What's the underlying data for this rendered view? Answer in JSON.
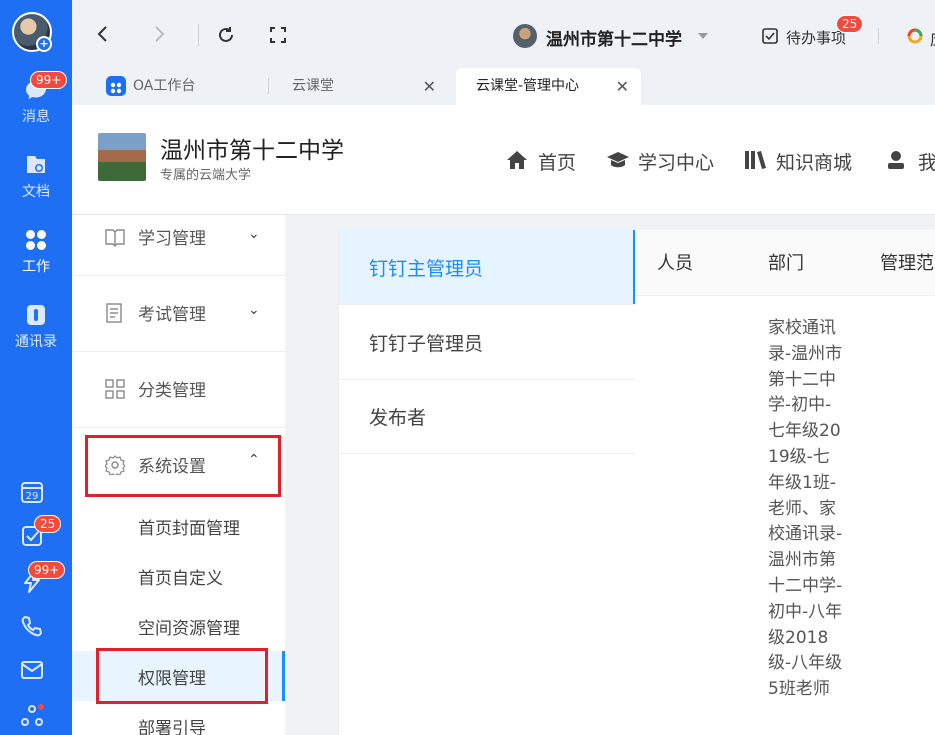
{
  "dock": {
    "items": [
      {
        "label": "消息",
        "badge": "99+"
      },
      {
        "label": "文档"
      },
      {
        "label": "工作"
      },
      {
        "label": "通讯录"
      }
    ],
    "mini": {
      "calendar_day": "29",
      "todo_badge": "25",
      "ding_badge": "99+"
    }
  },
  "topbar": {
    "org_name": "温州市第十二中学",
    "todo_label": "待办事项",
    "todo_badge": "25",
    "clipped_text": "应"
  },
  "tabs": [
    {
      "label": "OA工作台"
    },
    {
      "label": "云课堂"
    },
    {
      "label": "云课堂-管理中心"
    }
  ],
  "header": {
    "title": "温州市第十二中学",
    "subtitle": "专属的云端大学",
    "nav": [
      {
        "label": "首页"
      },
      {
        "label": "学习中心"
      },
      {
        "label": "知识商城"
      },
      {
        "label": "我"
      }
    ]
  },
  "sidebar": {
    "groups": [
      {
        "label": "学习管理"
      },
      {
        "label": "考试管理"
      },
      {
        "label": "分类管理"
      },
      {
        "label": "系统设置"
      }
    ],
    "subitems": [
      {
        "label": "首页封面管理"
      },
      {
        "label": "首页自定义"
      },
      {
        "label": "空间资源管理"
      },
      {
        "label": "权限管理"
      },
      {
        "label": "部署引导"
      }
    ]
  },
  "roles": [
    {
      "label": "钉钉主管理员"
    },
    {
      "label": "钉钉子管理员"
    },
    {
      "label": "发布者"
    }
  ],
  "table": {
    "columns": [
      "人员",
      "部门",
      "管理范"
    ],
    "dept_text": "家校通讯录-温州市第十二中学-初中-七年级2019级-七年级1班-老师、家校通讯录-温州市第十二中学-初中-八年级2018级-八年级5班老师"
  }
}
